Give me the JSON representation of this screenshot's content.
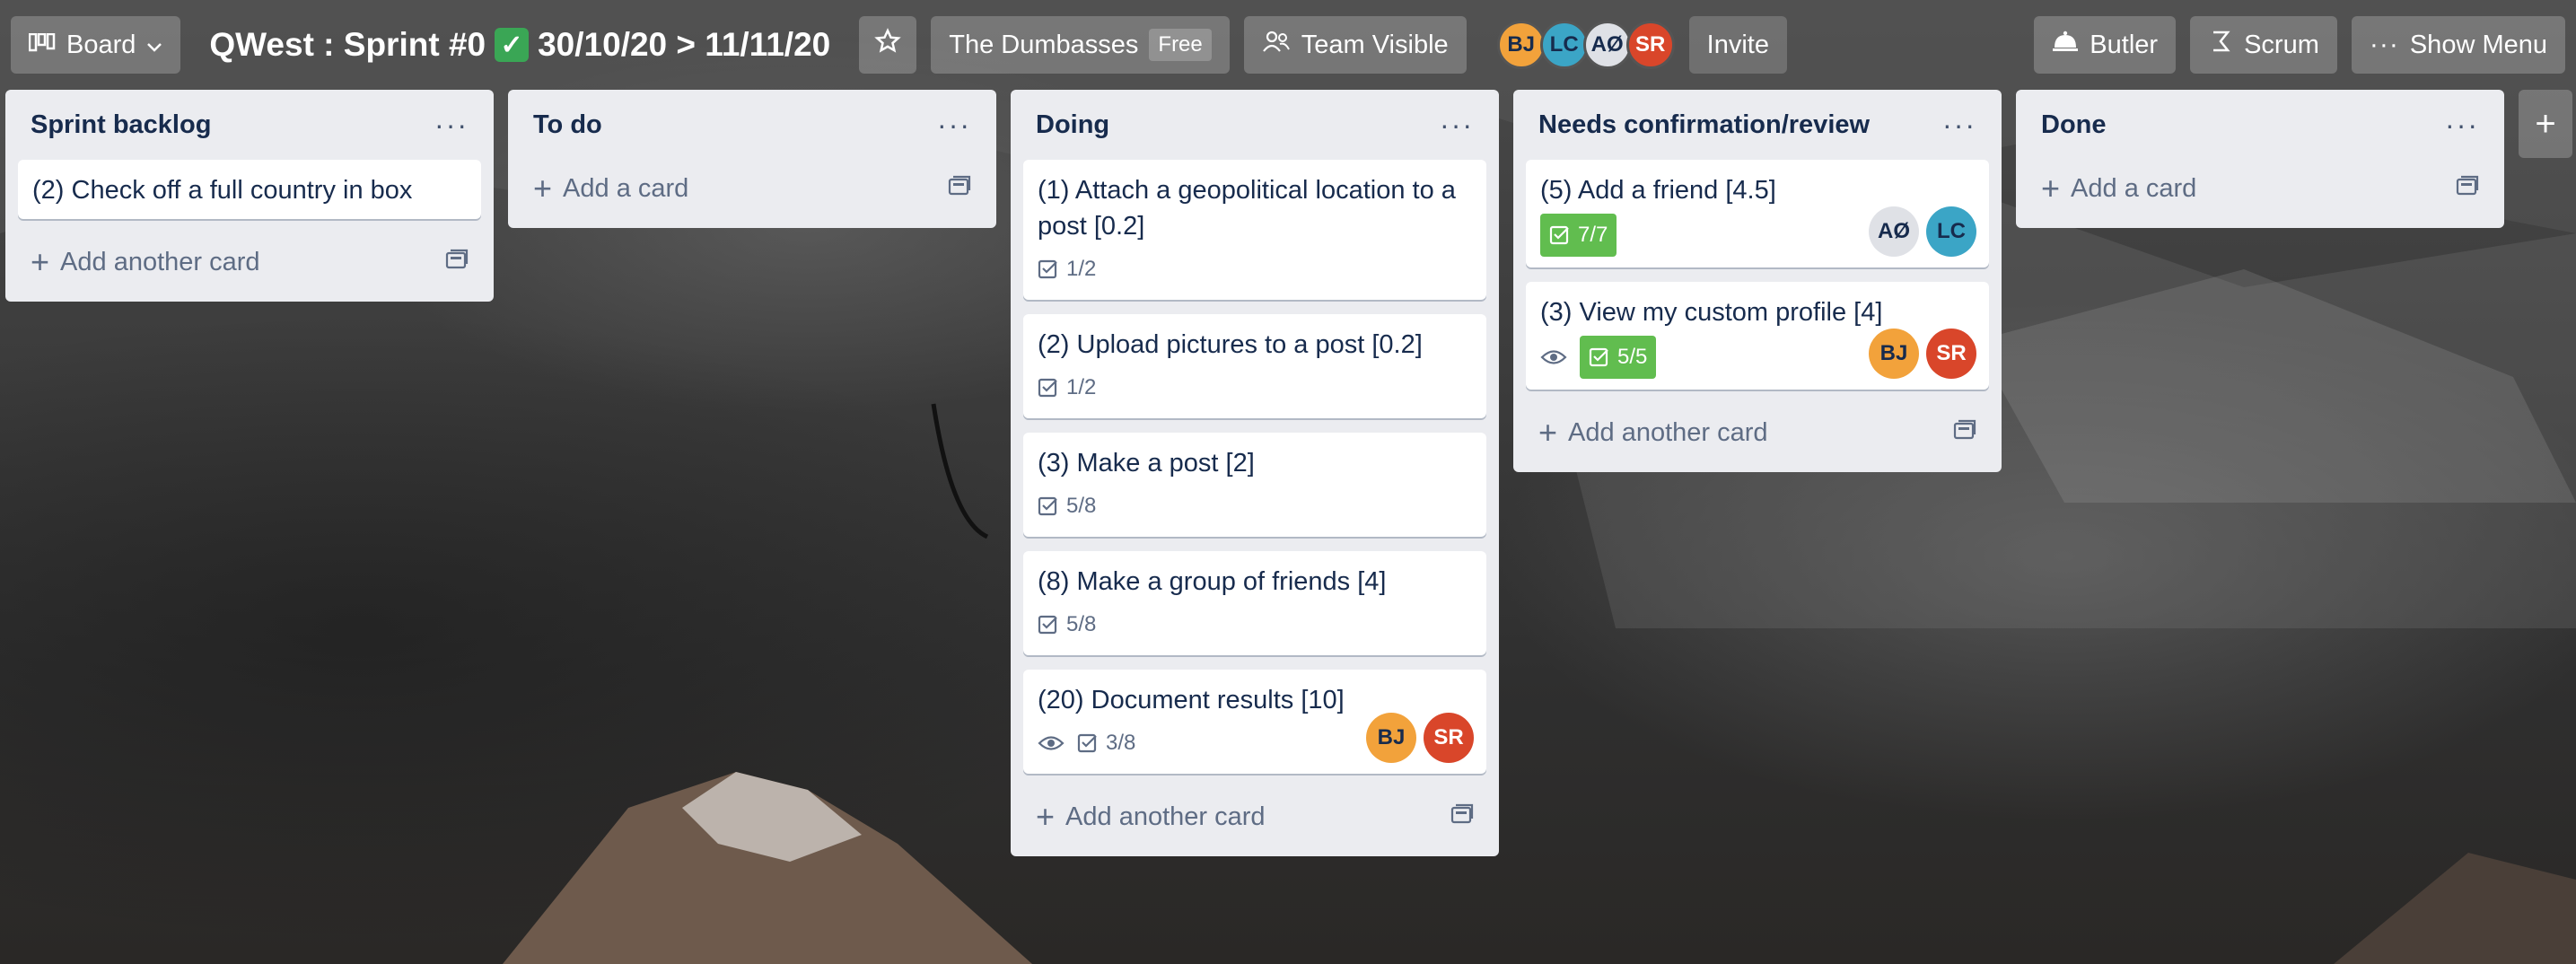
{
  "header": {
    "board_switcher": "Board",
    "board_title": "QWest : Sprint #0",
    "title_dates": "30/10/20 > 11/11/20",
    "team_name": "The Dumbasses",
    "team_plan": "Free",
    "visibility": "Team Visible",
    "members": [
      "BJ",
      "LC",
      "AØ",
      "SR"
    ],
    "invite": "Invite",
    "butler": "Butler",
    "scrum": "Scrum",
    "show_menu": "Show Menu"
  },
  "lists": [
    {
      "title": "Sprint backlog",
      "cards": [
        {
          "title": "(2) Check off a full country in box"
        }
      ],
      "add_label": "Add another card"
    },
    {
      "title": "To do",
      "cards": [],
      "add_label": "Add a card"
    },
    {
      "title": "Doing",
      "cards": [
        {
          "title": "(1) Attach a geopolitical location to a post [0.2]",
          "checklist": "1/2"
        },
        {
          "title": "(2) Upload pictures to a post [0.2]",
          "checklist": "1/2"
        },
        {
          "title": "(3) Make a post [2]",
          "checklist": "5/8"
        },
        {
          "title": "(8) Make a group of friends [4]",
          "checklist": "5/8"
        },
        {
          "title": "(20) Document results [10]",
          "checklist": "3/8",
          "watching": true,
          "members": [
            "BJ",
            "SR"
          ]
        }
      ],
      "add_label": "Add another card"
    },
    {
      "title": "Needs confirmation/review",
      "cards": [
        {
          "title": "(5) Add a friend [4.5]",
          "checklist": "7/7",
          "complete": true,
          "members": [
            "AØ",
            "LC"
          ]
        },
        {
          "title": "(3) View my custom profile [4]",
          "checklist": "5/5",
          "complete": true,
          "watching": true,
          "members": [
            "BJ",
            "SR"
          ]
        }
      ],
      "add_label": "Add another card"
    },
    {
      "title": "Done",
      "cards": [],
      "add_label": "Add a card"
    }
  ],
  "colors": {
    "list_bg": "#ebecf0",
    "complete_badge": "#61bd4f",
    "avatar_bj": "#f2a23b",
    "avatar_lc": "#3ba5c6",
    "avatar_ao": "#dfe1e6",
    "avatar_sr": "#d9462a"
  }
}
